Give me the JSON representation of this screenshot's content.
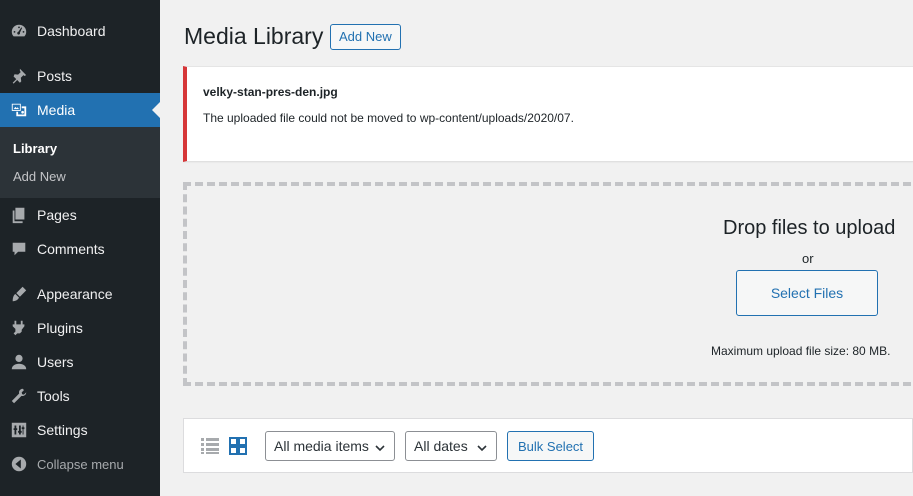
{
  "sidebar": {
    "items": [
      {
        "label": "Dashboard",
        "icon": "dashboard-icon"
      },
      {
        "label": "Posts",
        "icon": "pin-icon"
      },
      {
        "label": "Media",
        "icon": "media-icon"
      },
      {
        "label": "Pages",
        "icon": "pages-icon"
      },
      {
        "label": "Comments",
        "icon": "comment-icon"
      },
      {
        "label": "Appearance",
        "icon": "brush-icon"
      },
      {
        "label": "Plugins",
        "icon": "plugin-icon"
      },
      {
        "label": "Users",
        "icon": "user-icon"
      },
      {
        "label": "Tools",
        "icon": "wrench-icon"
      },
      {
        "label": "Settings",
        "icon": "settings-icon"
      }
    ],
    "submenu": [
      {
        "label": "Library"
      },
      {
        "label": "Add New"
      }
    ],
    "collapse_label": "Collapse menu"
  },
  "header": {
    "title": "Media Library",
    "add_new_label": "Add New"
  },
  "notice": {
    "filename": "velky-stan-pres-den.jpg",
    "message": "The uploaded file could not be moved to wp-content/uploads/2020/07."
  },
  "uploader": {
    "title": "Drop files to upload",
    "or": "or",
    "select_label": "Select Files",
    "max_size": "Maximum upload file size: 80 MB."
  },
  "toolbar": {
    "media_filter": "All media items",
    "date_filter": "All dates",
    "bulk_select_label": "Bulk Select"
  },
  "colors": {
    "sidebar_bg": "#1d2327",
    "accent": "#2271b1",
    "error": "#d63638"
  }
}
